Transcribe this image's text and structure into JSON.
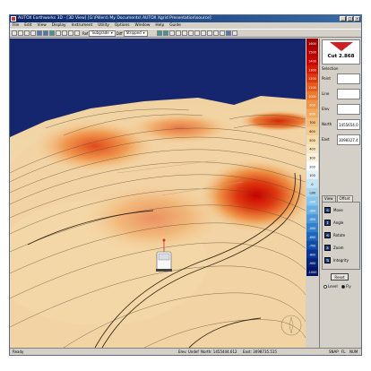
{
  "window": {
    "title": "AUTOX Earthworks 3D - [3D View] [G:\\Pillers\\ My Documents\\ AUTOX Xgrid Presentation\\source]"
  },
  "menu": [
    "File",
    "Edit",
    "View",
    "Display",
    "Instrument",
    "Utility",
    "Options",
    "Window",
    "Help",
    "Guide"
  ],
  "toolbar": {
    "ref_label": "Ref",
    "ref_value": "Subgrade",
    "diff_label": "Diff",
    "diff_value": "Stripped"
  },
  "legend": {
    "colors": [
      "#a00000",
      "#b60000",
      "#c80000",
      "#d41a00",
      "#dd3a10",
      "#e45a20",
      "#ea7a30",
      "#ee9448",
      "#f0aa60",
      "#f2bc78",
      "#f4cc90",
      "#f6daa8",
      "#f8e6c0",
      "#fbf0d8",
      "#ffffff",
      "#e4f0f8",
      "#c8e4f4",
      "#a8d4f0",
      "#88c4ea",
      "#68b0e2",
      "#4a98d8",
      "#3080cc",
      "#1c66bc",
      "#104ca8",
      "#083692",
      "#04247c",
      "#021668"
    ],
    "labels": [
      "1600",
      "1500",
      "1400",
      "1300",
      "1200",
      "1100",
      "1000",
      "900",
      "800",
      "700",
      "600",
      "500",
      "400",
      "300",
      "200",
      "100",
      "0",
      "-100",
      "-200",
      "-300",
      "-400",
      "-500",
      "-600",
      "-700",
      "-800",
      "-900",
      "-1000"
    ]
  },
  "panel": {
    "cut_label": "Cut 2.868",
    "selection_label": "Selection",
    "fields": [
      {
        "label": "Point",
        "value": ""
      },
      {
        "label": "Line",
        "value": ""
      },
      {
        "label": "Elev",
        "value": ""
      },
      {
        "label": "North",
        "value": "1455654.0"
      },
      {
        "label": "East",
        "value": "3098327.4"
      }
    ],
    "tabs": [
      "View",
      "Offset"
    ],
    "nav": [
      {
        "icon": "rotate-icon",
        "label": "Move"
      },
      {
        "icon": "tilt-icon",
        "label": "Angle"
      },
      {
        "icon": "rotate-icon",
        "label": "Rotate"
      },
      {
        "icon": "zoom-icon",
        "label": "Zoom"
      },
      {
        "icon": "height-icon",
        "label": "Integrity"
      }
    ],
    "reset": "Reset",
    "radio": [
      {
        "label": "Level",
        "on": false
      },
      {
        "label": "Fly",
        "on": true
      }
    ]
  },
  "status": {
    "ready": "Ready",
    "elev": "Elev: Undef",
    "north": "North: 1455444.612",
    "east": "East: 3098735.515",
    "snap": "SNAP",
    "fl": "FL",
    "num": "NUM"
  }
}
